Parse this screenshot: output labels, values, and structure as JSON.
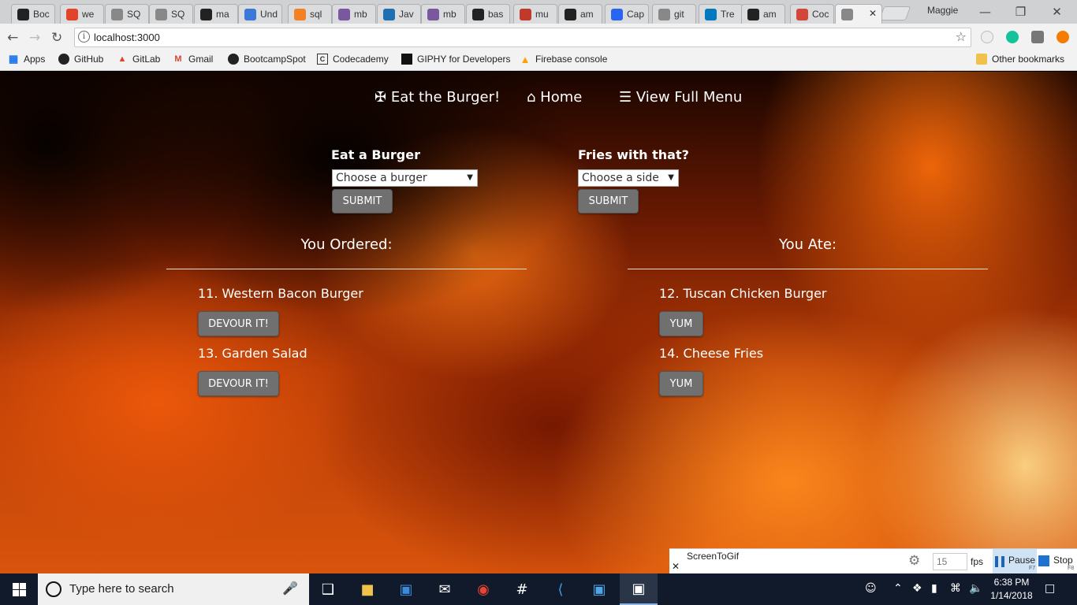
{
  "browser": {
    "tabs": [
      {
        "title": "Boc",
        "icon": "github-icon",
        "color": "#222222"
      },
      {
        "title": "we",
        "icon": "gitlab-icon",
        "color": "#e2432a"
      },
      {
        "title": "SQ",
        "icon": "database-icon",
        "color": "#888888"
      },
      {
        "title": "SQ",
        "icon": "database-icon",
        "color": "#888888"
      },
      {
        "title": "ma",
        "icon": "github-icon",
        "color": "#222222"
      },
      {
        "title": "Und",
        "icon": "js-icon",
        "color": "#3c78d8"
      },
      {
        "title": "sql",
        "icon": "stackoverflow-icon",
        "color": "#f48024"
      },
      {
        "title": "mb",
        "icon": "heroku-icon",
        "color": "#79589f"
      },
      {
        "title": "Jav",
        "icon": "edge-icon",
        "color": "#1f6fb3"
      },
      {
        "title": "mb",
        "icon": "heroku-icon",
        "color": "#79589f"
      },
      {
        "title": "bas",
        "icon": "github-icon",
        "color": "#222222"
      },
      {
        "title": "mu",
        "icon": "bookmark-icon",
        "color": "#c0392b"
      },
      {
        "title": "am",
        "icon": "github-icon",
        "color": "#222222"
      },
      {
        "title": "Cap",
        "icon": "css-icon",
        "color": "#2965f1"
      },
      {
        "title": "git",
        "icon": "page-icon",
        "color": "#888888"
      },
      {
        "title": "Tre",
        "icon": "trello-icon",
        "color": "#0079bf"
      },
      {
        "title": "am",
        "icon": "github-icon",
        "color": "#222222"
      },
      {
        "title": "Coc",
        "icon": "gmail-icon",
        "color": "#d44638"
      },
      {
        "title": "",
        "icon": "page-icon",
        "color": "#888888"
      }
    ],
    "profile_name": "Maggie",
    "url": "localhost:3000",
    "bookmarks": [
      {
        "label": "Apps",
        "icon": "apps-grid-icon"
      },
      {
        "label": "GitHub",
        "icon": "github-icon"
      },
      {
        "label": "GitLab",
        "icon": "gitlab-icon"
      },
      {
        "label": "Gmail",
        "icon": "gmail-icon"
      },
      {
        "label": "BootcampSpot",
        "icon": "github-icon"
      },
      {
        "label": "Codecademy",
        "icon": "codecademy-icon"
      },
      {
        "label": "GIPHY for Developers",
        "icon": "giphy-icon"
      },
      {
        "label": "Firebase console",
        "icon": "firebase-icon"
      }
    ],
    "other_bookmarks": "Other bookmarks"
  },
  "nav": {
    "brand": "Eat the Burger!",
    "home": "Home",
    "menu": "View Full Menu"
  },
  "order_form": {
    "burger_label": "Eat a Burger",
    "burger_select": "Choose a burger",
    "burger_submit": "SUBMIT",
    "side_label": "Fries with that?",
    "side_select": "Choose a side",
    "side_submit": "SUBMIT"
  },
  "ordered": {
    "heading": "You Ordered:",
    "items": [
      {
        "name": "11. Western Bacon Burger",
        "button": "DEVOUR IT!"
      },
      {
        "name": "13. Garden Salad",
        "button": "DEVOUR IT!"
      }
    ]
  },
  "eaten": {
    "heading": "You Ate:",
    "items": [
      {
        "name": "12. Tuscan Chicken Burger",
        "button": "YUM"
      },
      {
        "name": "14. Cheese Fries",
        "button": "YUM"
      }
    ]
  },
  "screentogif": {
    "title": "ScreenToGif",
    "fps_value": "15",
    "fps_label": "fps",
    "pause": "Pause",
    "pause_key": "F7",
    "stop": "Stop",
    "stop_key": "F8"
  },
  "taskbar": {
    "search_placeholder": "Type here to search",
    "time": "6:38 PM",
    "date": "1/14/2018"
  }
}
